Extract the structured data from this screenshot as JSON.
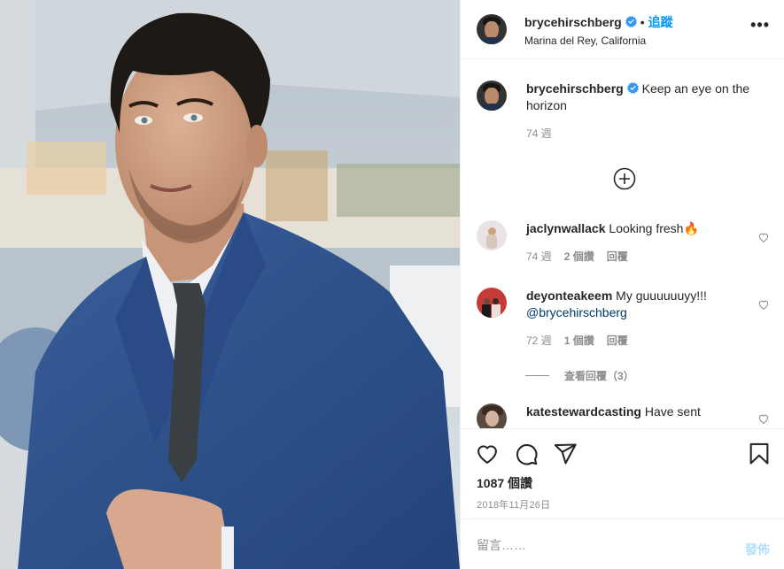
{
  "post": {
    "username": "brycehirschberg",
    "follow_label": "追蹤",
    "dot": "•",
    "location": "Marina del Rey, California",
    "more_label": "•••"
  },
  "caption": {
    "username": "brycehirschberg",
    "text": "Keep an eye on the horizon",
    "time": "74 週"
  },
  "comments": [
    {
      "username": "jaclynwallack",
      "text": "Looking fresh🔥",
      "time": "74 週",
      "likes": "2 個讚",
      "reply": "回覆"
    },
    {
      "username": "deyonteakeem",
      "text": "My guuuuuuyy!!!",
      "mention": "@brycehirschberg",
      "time": "72 週",
      "likes": "1 個讚",
      "reply": "回覆"
    },
    {
      "username": "katestewardcasting",
      "text": "Have sent"
    }
  ],
  "view_replies": "查看回覆（3）",
  "actions": {
    "like_count": "1087 個讚",
    "date": "2018年11月26日"
  },
  "composer": {
    "placeholder": "留言……",
    "post_label": "發佈"
  },
  "icons": {
    "verified": "verified-badge-icon",
    "heart": "heart-icon",
    "comment": "comment-icon",
    "share": "share-icon",
    "save": "bookmark-icon",
    "add": "plus-circle-icon",
    "accent": "#0095f6"
  }
}
